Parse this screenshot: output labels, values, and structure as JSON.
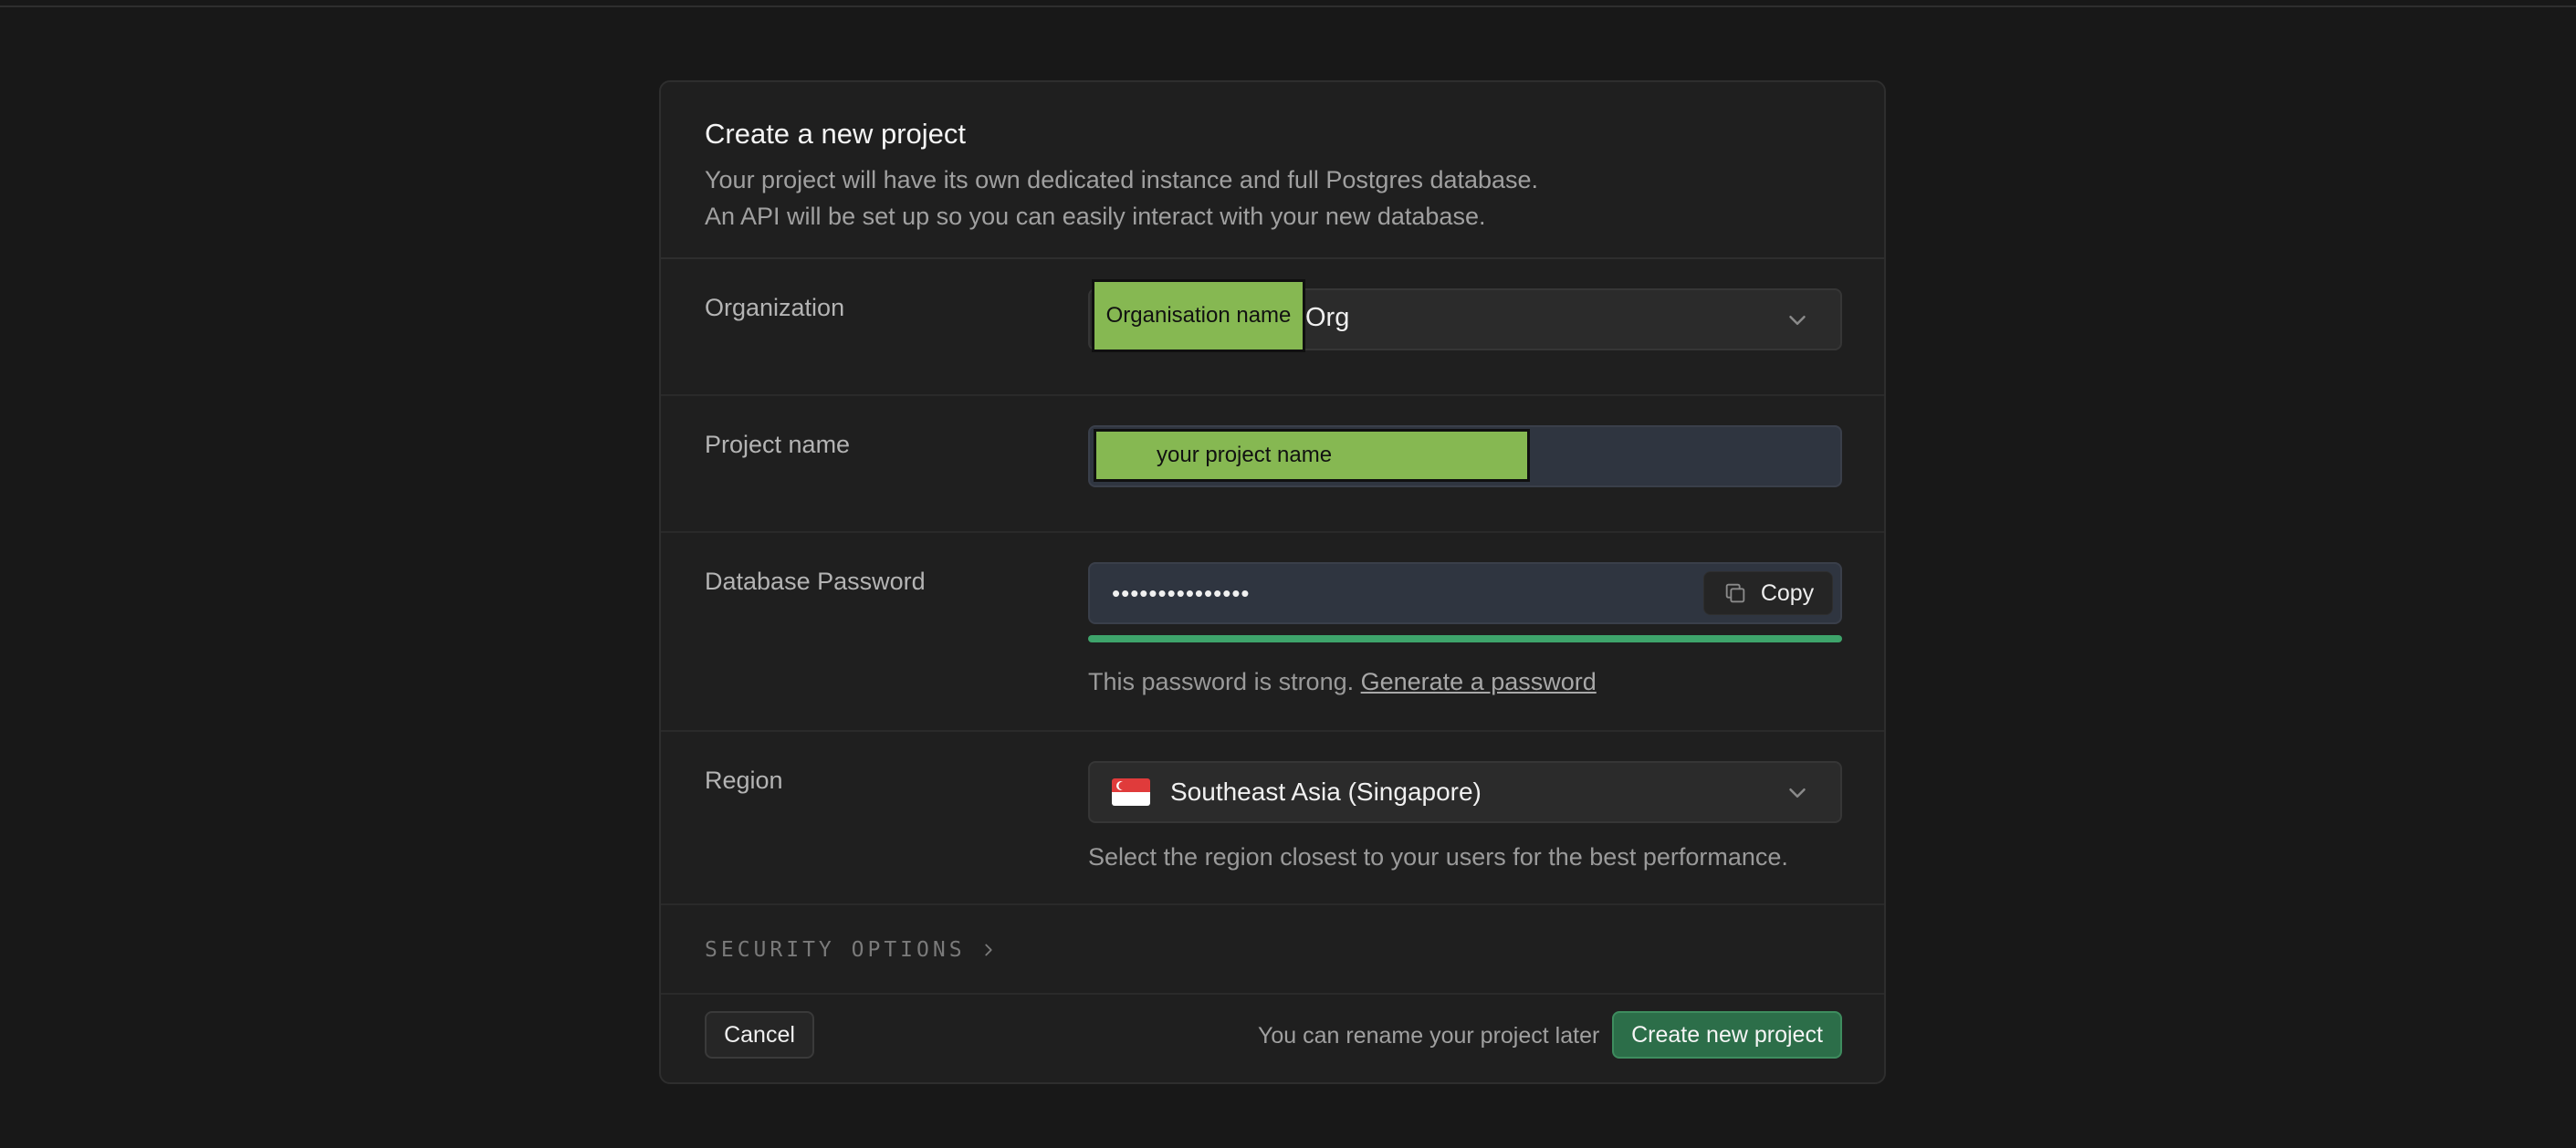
{
  "modal": {
    "title": "Create a new project",
    "description_line1": "Your project will have its own dedicated instance and full Postgres database.",
    "description_line2": "An API will be set up so you can easily interact with your new database."
  },
  "organization": {
    "label": "Organization",
    "redacted_tag": "Organisation name",
    "value": "Org",
    "icon": "chevron-down-icon"
  },
  "project_name": {
    "label": "Project name",
    "redacted_value": "your project name"
  },
  "database_password": {
    "label": "Database Password",
    "value_masked": "•••••••••••••••",
    "copy_label": "Copy",
    "strength_fraction": 1.0,
    "strength_color": "#3ea46b",
    "helper_text": "This password is strong.",
    "generate_link": "Generate a password"
  },
  "region": {
    "label": "Region",
    "value": "Southeast Asia (Singapore)",
    "flag_icon": "singapore-flag-icon",
    "helper_text": "Select the region closest to your users for the best performance."
  },
  "security": {
    "label": "SECURITY OPTIONS",
    "icon": "chevron-right-icon"
  },
  "footer": {
    "cancel_label": "Cancel",
    "note": "You can rename your project later",
    "create_label": "Create new project"
  },
  "colors": {
    "background": "#181818",
    "modal": "#1f1f1f",
    "accent_green": "#2c6e49",
    "redaction": "#86b852"
  }
}
